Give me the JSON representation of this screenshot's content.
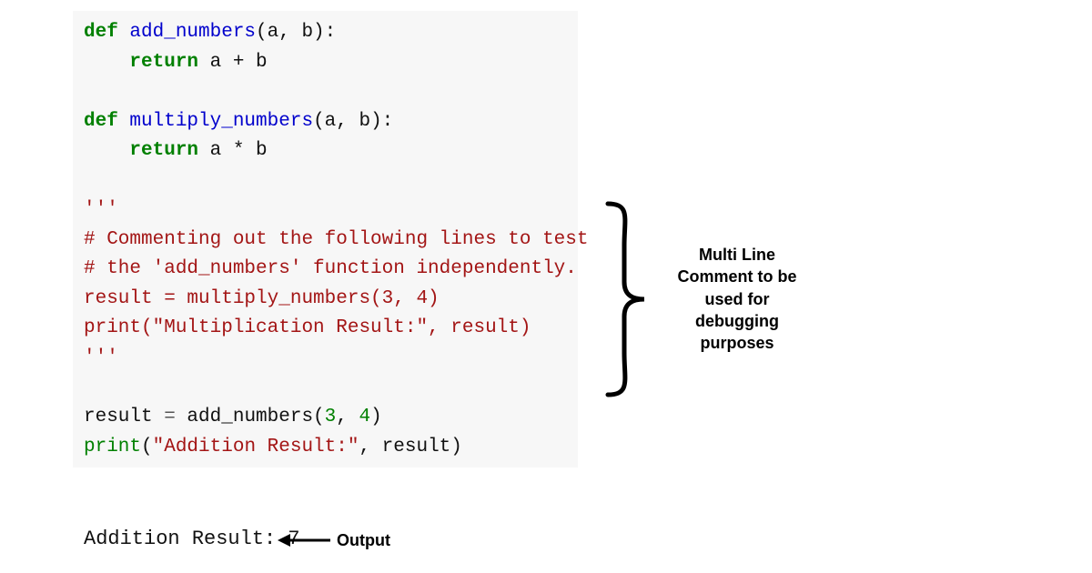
{
  "code": {
    "l1_def": "def",
    "l1_fn": " add_numbers",
    "l1_rest": "(a, b):",
    "l2_ret": "    return",
    "l2_rest": " a + b",
    "l3_blank": " ",
    "l4_def": "def",
    "l4_fn": " multiply_numbers",
    "l4_rest": "(a, b):",
    "l5_ret": "    return",
    "l5_rest": " a * b",
    "l6_blank": " ",
    "l7_tq": "'''",
    "l8": "# Commenting out the following lines to test",
    "l9": "# the 'add_numbers' function independently.",
    "l10": "result = multiply_numbers(3, 4)",
    "l11": "print(\"Multiplication Result:\", result)",
    "l12_tq": "'''",
    "l13_blank": " ",
    "l14a": "result ",
    "l14b": "=",
    "l14c": " add_numbers(",
    "l14d": "3",
    "l14e": ", ",
    "l14f": "4",
    "l14g": ")",
    "l15a": "print",
    "l15b": "(",
    "l15c": "\"Addition Result:\"",
    "l15d": ", result)"
  },
  "output": "Addition Result: 7",
  "output_label": "Output",
  "annotation": "Multi Line Comment to be used for debugging purposes"
}
